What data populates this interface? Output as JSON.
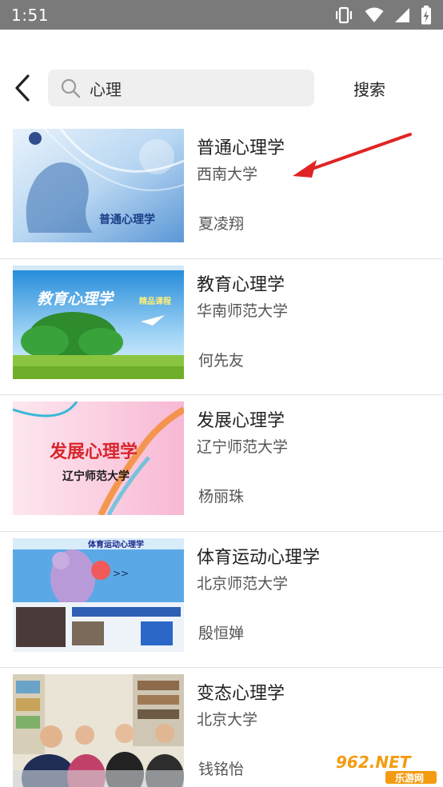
{
  "status_bar": {
    "time": "1:51",
    "icons": [
      "vibrate-icon",
      "wifi-icon",
      "signal-icon",
      "battery-charging-icon"
    ]
  },
  "search": {
    "query": "心理",
    "button_label": "搜索"
  },
  "courses": [
    {
      "title": "普通心理学",
      "school": "西南大学",
      "teacher": "夏凌翔",
      "thumb_text": "普通心理学"
    },
    {
      "title": "教育心理学",
      "school": "华南师范大学",
      "teacher": "何先友",
      "thumb_text": "教育心理学",
      "thumb_sub": "精品课程"
    },
    {
      "title": "发展心理学",
      "school": "辽宁师范大学",
      "teacher": "杨丽珠",
      "thumb_text": "发展心理学",
      "thumb_sub": "辽宁师范大学"
    },
    {
      "title": "体育运动心理学",
      "school": "北京师范大学",
      "teacher": "殷恒婵",
      "thumb_text": "体育运动心理学"
    },
    {
      "title": "变态心理学",
      "school": "北京大学",
      "teacher": "钱铭怡"
    }
  ],
  "watermark": {
    "text": "962.NET",
    "sub": "乐游网"
  }
}
